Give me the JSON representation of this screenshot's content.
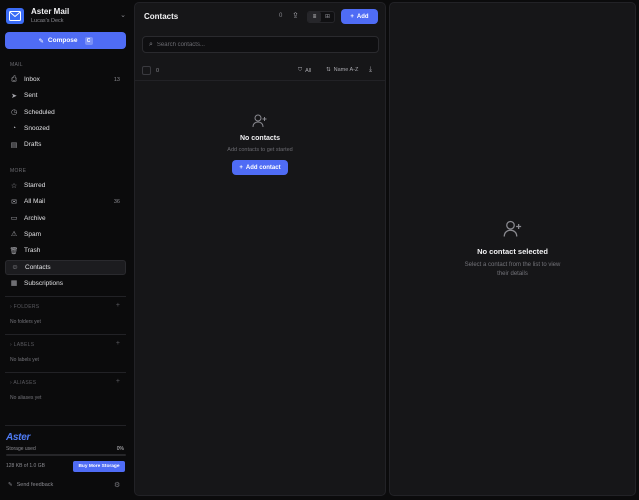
{
  "brand": {
    "title": "Aster Mail",
    "subtitle": "Lucas's Deck"
  },
  "compose": {
    "label": "Compose",
    "shortcut": "C"
  },
  "sections": {
    "mail": "MAIL",
    "more": "MORE"
  },
  "mail_items": [
    {
      "label": "Inbox",
      "count": "13",
      "icon": "inbox-icon"
    },
    {
      "label": "Sent",
      "count": "",
      "icon": "send-icon"
    },
    {
      "label": "Scheduled",
      "count": "",
      "icon": "clock-icon"
    },
    {
      "label": "Snoozed",
      "count": "",
      "icon": "snooze-icon"
    },
    {
      "label": "Drafts",
      "count": "",
      "icon": "draft-icon"
    }
  ],
  "more_items": [
    {
      "label": "Starred",
      "count": "",
      "icon": "star-icon"
    },
    {
      "label": "All Mail",
      "count": "36",
      "icon": "mail-icon"
    },
    {
      "label": "Archive",
      "count": "",
      "icon": "archive-icon"
    },
    {
      "label": "Spam",
      "count": "",
      "icon": "warning-icon"
    },
    {
      "label": "Trash",
      "count": "",
      "icon": "trash-icon"
    },
    {
      "label": "Contacts",
      "count": "",
      "icon": "contacts-icon",
      "active": true
    },
    {
      "label": "Subscriptions",
      "count": "",
      "icon": "subscriptions-icon"
    }
  ],
  "groups": [
    {
      "label": "FOLDERS",
      "empty": "No folders yet"
    },
    {
      "label": "LABELS",
      "empty": "No labels yet"
    },
    {
      "label": "ALIASES",
      "empty": "No aliases yet"
    }
  ],
  "footer": {
    "logo": "Aster",
    "storage_label": "Storage used",
    "storage_pct": "0%",
    "storage_fraction": 0.0,
    "storage_used": "128 KB of 1.0 GB",
    "buy_label": "Buy More Storage",
    "feedback": "Send feedback"
  },
  "list": {
    "title": "Contacts",
    "count": "0",
    "add_label": "Add",
    "search_placeholder": "Search contacts...",
    "selected_count": "0",
    "filter_label": "All",
    "sort_label": "Name A-Z",
    "empty_title": "No contacts",
    "empty_sub": "Add contacts to get started",
    "add_contact_label": "Add contact"
  },
  "detail": {
    "empty_title": "No contact selected",
    "empty_sub_1": "Select a contact from the list to view",
    "empty_sub_2": "their details"
  },
  "colors": {
    "accent": "#4f6cf5",
    "background": "#0b0b0c",
    "panel": "#161618"
  }
}
